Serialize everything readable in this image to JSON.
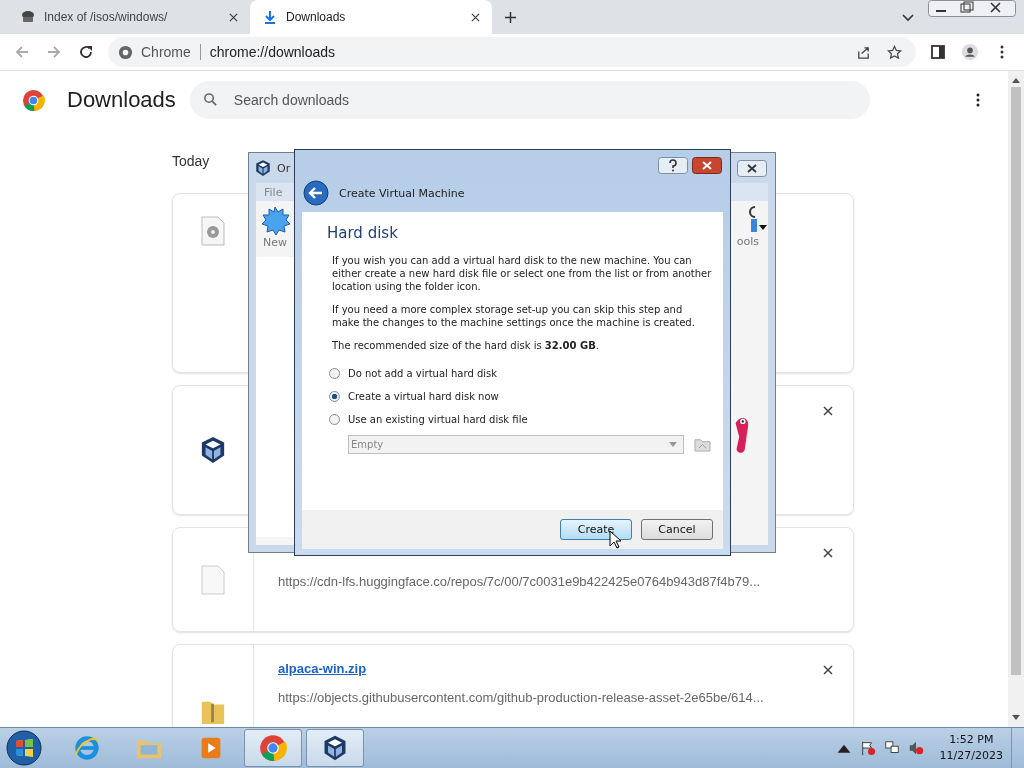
{
  "tabs": [
    {
      "title": "Index of /isos/windows/",
      "kind": "site",
      "selected": false
    },
    {
      "title": "Downloads",
      "kind": "download",
      "selected": true
    }
  ],
  "address": {
    "chip": "Chrome",
    "url": "chrome://downloads"
  },
  "page": {
    "title": "Downloads",
    "search_placeholder": "Search downloads",
    "section": "Today"
  },
  "downloads": [
    {
      "kind": "disc",
      "closable": false
    },
    {
      "kind": "cube",
      "closable": true
    },
    {
      "kind": "file",
      "url": "https://cdn-lfs.huggingface.co/repos/7c/00/7c0031e9b422425e0764b943d87f4b79...",
      "closable": true
    },
    {
      "kind": "zip",
      "name": "alpaca-win.zip",
      "url": "https://objects.githubusercontent.com/github-production-release-asset-2e65be/614...",
      "closable": true
    }
  ],
  "vbox_window": {
    "title": "Or",
    "menu": [
      "File"
    ],
    "tools": [
      {
        "label": "New",
        "kind": "new"
      },
      {
        "label": "ools",
        "kind": "tools"
      }
    ]
  },
  "dialog": {
    "title": "Create Virtual Machine",
    "heading": "Hard disk",
    "paragraphs": [
      "If you wish you can add a virtual hard disk to the new machine. You can either create a new hard disk file or select one from the list or from another location using the folder icon.",
      "If you need a more complex storage set-up you can skip this step and make the changes to the machine settings once the machine is created.",
      "The recommended size of the hard disk is **32.00 GB**."
    ],
    "options": [
      {
        "label": "Do not add a virtual hard disk",
        "selected": false
      },
      {
        "label": "Create a virtual hard disk now",
        "selected": true
      },
      {
        "label": "Use an existing virtual hard disk file",
        "selected": false
      }
    ],
    "combo": {
      "value": "Empty",
      "disabled": true
    },
    "buttons": [
      {
        "label": "Create",
        "default": true
      },
      {
        "label": "Cancel",
        "default": false
      }
    ]
  },
  "taskbar": {
    "apps": [
      {
        "kind": "ie",
        "active": false
      },
      {
        "kind": "explorer",
        "active": false
      },
      {
        "kind": "media",
        "active": false
      },
      {
        "kind": "chrome",
        "active": true
      },
      {
        "kind": "vbox",
        "active": true
      }
    ],
    "time": "1:52 PM",
    "date": "11/27/2023"
  }
}
